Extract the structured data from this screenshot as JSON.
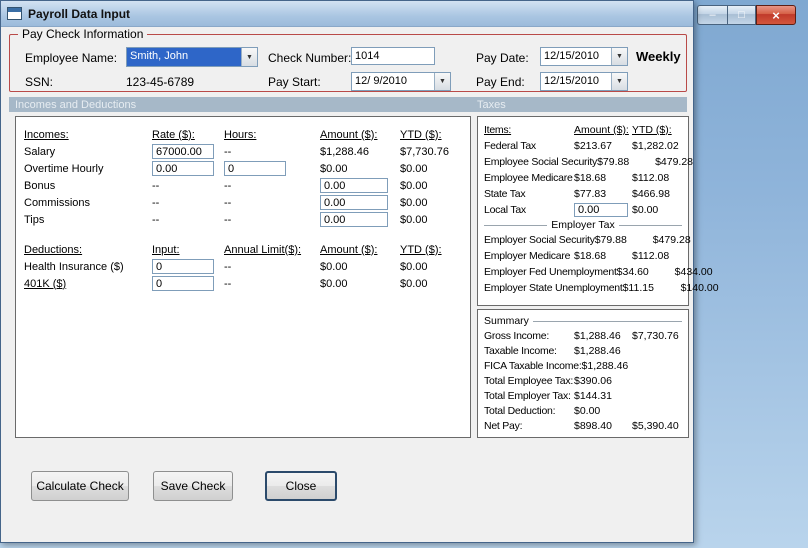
{
  "window": {
    "title": "Payroll Data Input"
  },
  "icons": {
    "minimize": "–",
    "maximize": "□",
    "close": "×",
    "dropdown": "▼"
  },
  "colors": {
    "groupbox_border": "#b94a48",
    "section_strip": "#a6b8c8",
    "combo_selection": "#2e66c8",
    "close_button_red": "#c0392a"
  },
  "paycheck": {
    "group_label": "Pay Check Information",
    "employee_name": {
      "label": "Employee Name:",
      "value": "Smith, John"
    },
    "ssn": {
      "label": "SSN:",
      "value": "123-45-6789"
    },
    "check_number": {
      "label": "Check Number:",
      "value": "1014"
    },
    "pay_start": {
      "label": "Pay Start:",
      "value": "12/ 9/2010"
    },
    "pay_date": {
      "label": "Pay Date:",
      "value": "12/15/2010"
    },
    "pay_end": {
      "label": "Pay End:",
      "value": "12/15/2010"
    },
    "frequency": "Weekly"
  },
  "sections": {
    "incomes_header": "Incomes and Deductions",
    "taxes_header": "Taxes"
  },
  "incomes": {
    "headers": {
      "name": "Incomes:",
      "rate": "Rate ($):",
      "hours": "Hours:",
      "amount": "Amount ($):",
      "ytd": "YTD ($):"
    },
    "salary": {
      "label": "Salary",
      "rate": "67000.00",
      "hours": "--",
      "amount": "$1,288.46",
      "ytd": "$7,730.76"
    },
    "overtime": {
      "label": "Overtime Hourly",
      "rate": "0.00",
      "hours": "0",
      "amount": "$0.00",
      "ytd": "$0.00"
    },
    "bonus": {
      "label": "Bonus",
      "rate": "--",
      "hours": "--",
      "amount": "0.00",
      "ytd": "$0.00"
    },
    "commissions": {
      "label": "Commissions",
      "rate": "--",
      "hours": "--",
      "amount": "0.00",
      "ytd": "$0.00"
    },
    "tips": {
      "label": "Tips",
      "rate": "--",
      "hours": "--",
      "amount": "0.00",
      "ytd": "$0.00"
    }
  },
  "deductions": {
    "headers": {
      "name": "Deductions:",
      "input": "Input:",
      "limit": "Annual Limit($):",
      "amount": "Amount ($):",
      "ytd": "YTD ($):"
    },
    "health": {
      "label": "Health Insurance  ($)",
      "input": "0",
      "limit": "--",
      "amount": "$0.00",
      "ytd": "$0.00"
    },
    "k401": {
      "label": "401K  ($)",
      "input": "0",
      "limit": "--",
      "amount": "$0.00",
      "ytd": "$0.00"
    }
  },
  "taxes": {
    "headers": {
      "items": "Items:",
      "amount": "Amount ($):",
      "ytd": "YTD ($):"
    },
    "rows": [
      {
        "label": "Federal Tax",
        "amount": "$213.67",
        "ytd": "$1,282.02"
      },
      {
        "label": "Employee Social Security",
        "amount": "$79.88",
        "ytd": "$479.28"
      },
      {
        "label": "Employee Medicare",
        "amount": "$18.68",
        "ytd": "$112.08"
      },
      {
        "label": "State Tax",
        "amount": "$77.83",
        "ytd": "$466.98"
      }
    ],
    "local_tax": {
      "label": "Local Tax",
      "amount": "0.00",
      "ytd": "$0.00"
    },
    "employer_header": "Employer Tax",
    "employer_rows": [
      {
        "label": "Employer Social Security",
        "amount": "$79.88",
        "ytd": "$479.28"
      },
      {
        "label": "Employer Medicare",
        "amount": "$18.68",
        "ytd": "$112.08"
      },
      {
        "label": "Employer Fed Unemployment",
        "amount": "$34.60",
        "ytd": "$434.00"
      },
      {
        "label": "Employer State Unemployment",
        "amount": "$11.15",
        "ytd": "$140.00"
      }
    ]
  },
  "summary": {
    "title": "Summary",
    "rows": [
      {
        "label": "Gross Income:",
        "amount": "$1,288.46",
        "ytd": "$7,730.76"
      },
      {
        "label": "Taxable Income:",
        "amount": "$1,288.46",
        "ytd": ""
      },
      {
        "label": "FICA Taxable Income:",
        "amount": "$1,288.46",
        "ytd": ""
      },
      {
        "label": "Total Employee Tax:",
        "amount": "$390.06",
        "ytd": ""
      },
      {
        "label": "Total Employer Tax:",
        "amount": "$144.31",
        "ytd": ""
      },
      {
        "label": "Total Deduction:",
        "amount": "$0.00",
        "ytd": ""
      },
      {
        "label": "Net Pay:",
        "amount": "$898.40",
        "ytd": "$5,390.40"
      }
    ]
  },
  "buttons": {
    "calculate": "Calculate Check",
    "save": "Save Check",
    "close": "Close"
  }
}
